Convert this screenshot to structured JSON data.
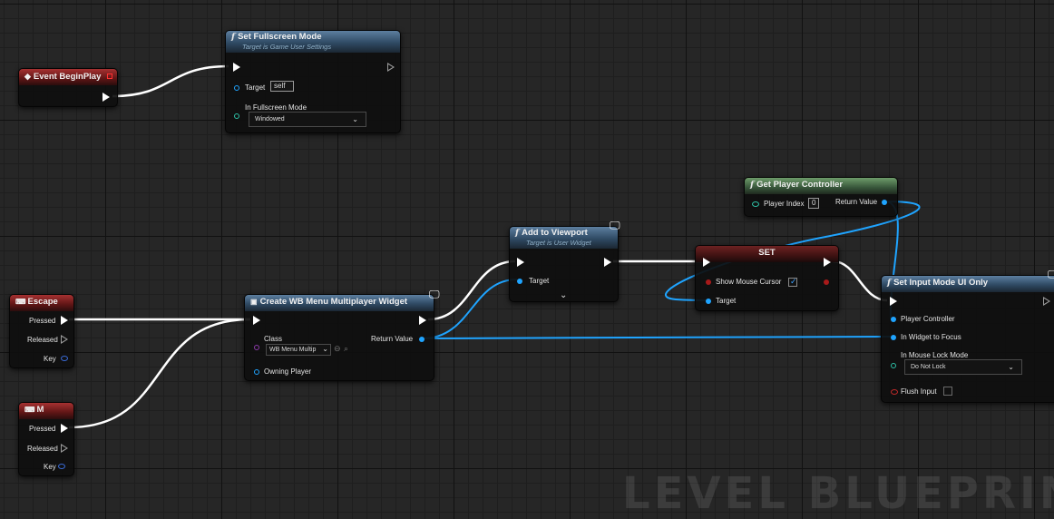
{
  "watermark": "LEVEL BLUEPRINT",
  "colors": {
    "exec_wire": "#ffffff",
    "object_wire": "#1fa4ff",
    "grid": "#262626"
  },
  "nodes": {
    "event_begin_play": {
      "title": "Event BeginPlay"
    },
    "set_fullscreen": {
      "title": "Set Fullscreen Mode",
      "subtitle": "Target is Game User Settings",
      "target_label": "Target",
      "target_value": "self",
      "mode_label": "In Fullscreen Mode",
      "mode_value": "Windowed"
    },
    "escape_event": {
      "title": "Escape",
      "pressed": "Pressed",
      "released": "Released",
      "key": "Key"
    },
    "m_event": {
      "title": "M",
      "pressed": "Pressed",
      "released": "Released",
      "key": "Key"
    },
    "create_widget": {
      "title": "Create WB Menu Multiplayer Widget",
      "class_label": "Class",
      "class_value": "WB Menu Multip",
      "return_label": "Return Value",
      "owning_label": "Owning Player"
    },
    "add_to_viewport": {
      "title": "Add to Viewport",
      "subtitle": "Target is User Widget",
      "target_label": "Target"
    },
    "get_player_controller": {
      "title": "Get Player Controller",
      "index_label": "Player Index",
      "index_value": "0",
      "return_label": "Return Value"
    },
    "set_node": {
      "title": "SET",
      "show_cursor_label": "Show Mouse Cursor",
      "show_cursor_checked": true,
      "target_label": "Target"
    },
    "set_input_mode": {
      "title": "Set Input Mode UI Only",
      "pc_label": "Player Controller",
      "widget_label": "In Widget to Focus",
      "lock_label": "In Mouse Lock Mode",
      "lock_value": "Do Not Lock",
      "flush_label": "Flush Input",
      "flush_checked": false
    }
  }
}
